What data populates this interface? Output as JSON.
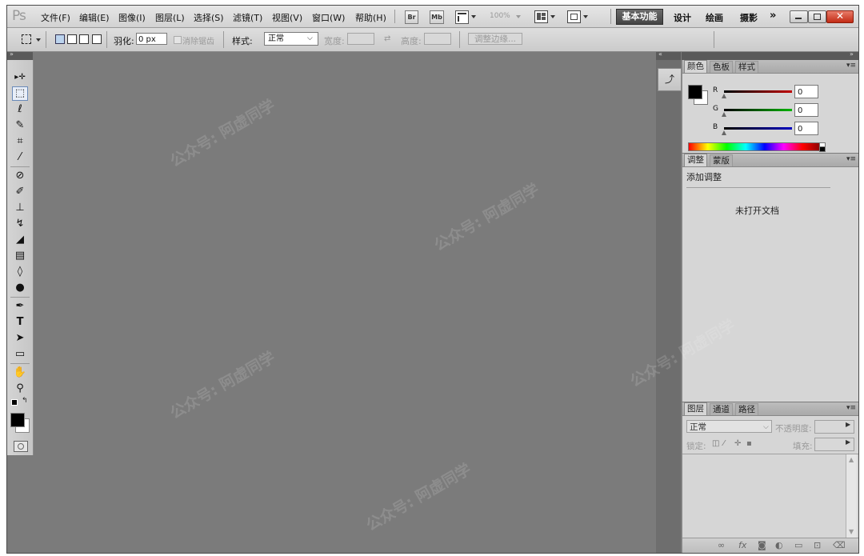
{
  "app": {
    "logo": "Ps",
    "menu": [
      "文件(F)",
      "编辑(E)",
      "图像(I)",
      "图层(L)",
      "选择(S)",
      "滤镜(T)",
      "视图(V)",
      "窗口(W)",
      "帮助(H)"
    ],
    "bridge_label": "Br",
    "minibridge_label": "Mb",
    "zoom": "100%",
    "workspaces": {
      "active": "基本功能",
      "others": [
        "设计",
        "绘画",
        "摄影"
      ],
      "more": "»"
    }
  },
  "options": {
    "feather_label": "羽化:",
    "feather_value": "0 px",
    "antialias_label": "消除锯齿",
    "style_label": "样式:",
    "style_value": "正常",
    "width_label": "宽度:",
    "height_label": "高度:",
    "refine_label": "调整边缘..."
  },
  "color_panel": {
    "tabs": [
      "颜色",
      "色板",
      "样式"
    ],
    "sliders": [
      {
        "label": "R",
        "value": "0"
      },
      {
        "label": "G",
        "value": "0"
      },
      {
        "label": "B",
        "value": "0"
      }
    ]
  },
  "adjust_panel": {
    "tabs": [
      "调整",
      "蒙版"
    ],
    "heading": "添加调整",
    "message": "未打开文档"
  },
  "layers_panel": {
    "tabs": [
      "图层",
      "通道",
      "路径"
    ],
    "blend_mode": "正常",
    "opacity_label": "不透明度:",
    "lock_label": "锁定:",
    "fill_label": "填充:",
    "footer_icons": [
      "link-icon",
      "fx-icon",
      "mask-icon",
      "adjustment-icon",
      "folder-icon",
      "new-layer-icon",
      "trash-icon"
    ]
  },
  "watermark": "公众号: 阿虚同学",
  "colors": {
    "canvas": "#7b7b7b",
    "r_slider": "#c00000",
    "g_slider": "#00b400",
    "b_slider": "#0000c0"
  }
}
